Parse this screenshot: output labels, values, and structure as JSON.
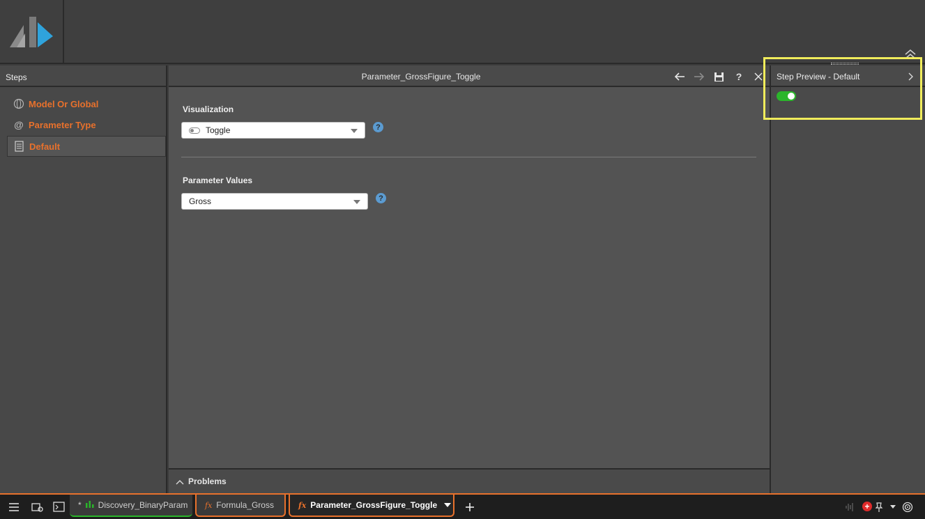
{
  "steps": {
    "header": "Steps",
    "items": [
      {
        "label": "Model Or Global"
      },
      {
        "label": "Parameter Type"
      },
      {
        "label": "Default"
      }
    ]
  },
  "main": {
    "title": "Parameter_GrossFigure_Toggle",
    "visualization": {
      "label": "Visualization",
      "selected": "Toggle"
    },
    "parameter_values": {
      "label": "Parameter Values",
      "selected": "Gross"
    },
    "help_symbol": "?",
    "problems_label": "Problems"
  },
  "preview": {
    "title": "Step Preview - Default",
    "toggle_on": true
  },
  "taskbar": {
    "tabs": [
      {
        "prefix": "*",
        "label": "Discovery_BinaryParam"
      },
      {
        "label": "Formula_Gross"
      },
      {
        "label": "Parameter_GrossFigure_Toggle"
      }
    ]
  },
  "colors": {
    "accent": "#e8712c",
    "highlight": "#f0ec5b",
    "toggle_on": "#2bb52b",
    "help": "#5b9bd1"
  }
}
